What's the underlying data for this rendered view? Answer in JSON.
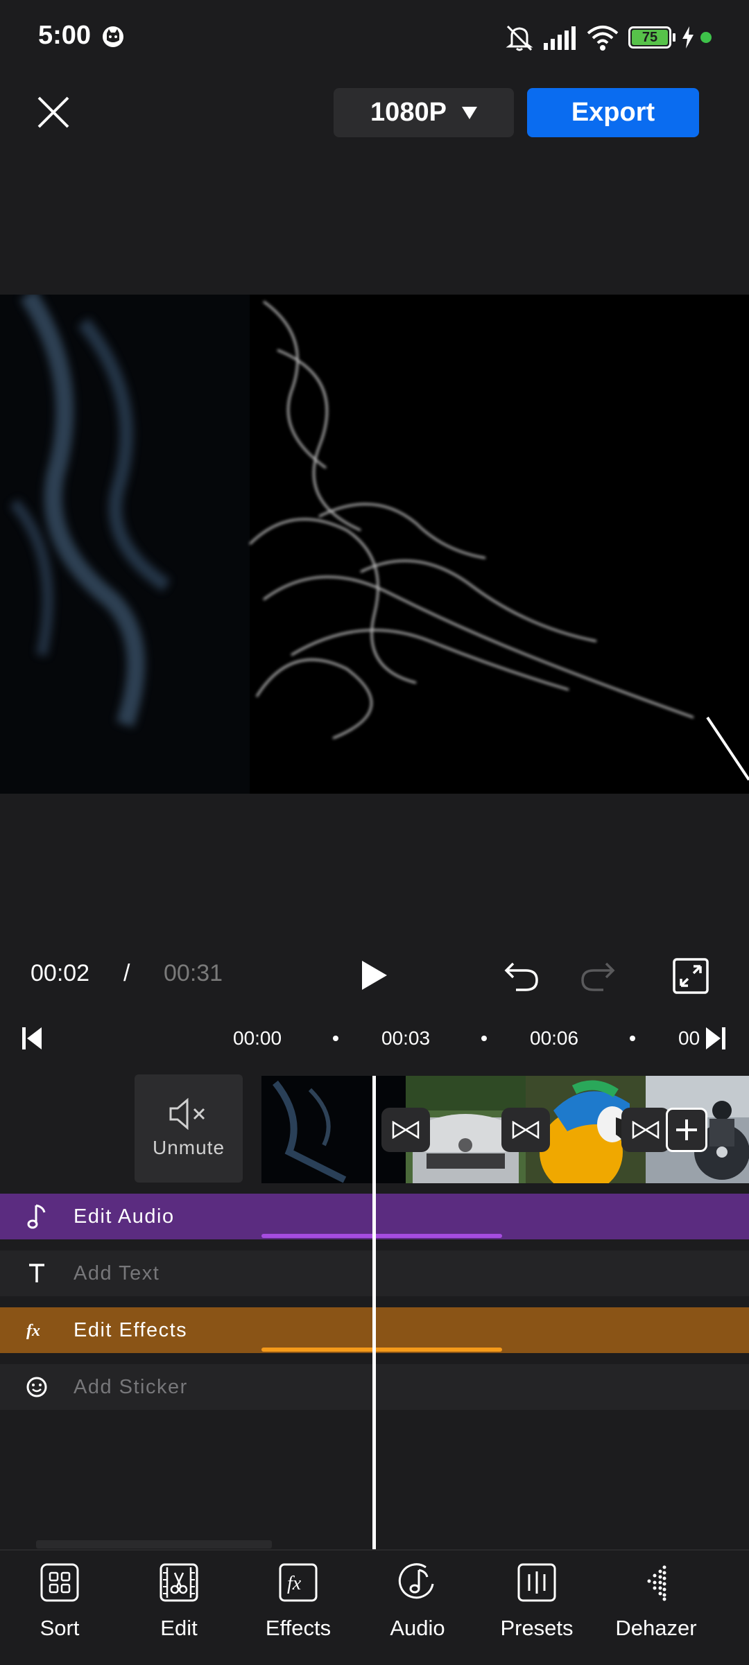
{
  "status_bar": {
    "time": "5:00",
    "battery_level": "75",
    "icons": [
      "cat-notification-icon",
      "mute-icon",
      "signal-icon",
      "wifi-icon",
      "battery-icon",
      "charging-icon",
      "dot-icon"
    ]
  },
  "top_bar": {
    "resolution": "1080P",
    "export_label": "Export",
    "close_icon": "close-icon"
  },
  "playback": {
    "current_time": "00:02",
    "separator": "/",
    "total_time": "00:31"
  },
  "ruler": {
    "ticks": [
      "00:00",
      "00:03",
      "00:06",
      "00"
    ]
  },
  "timeline": {
    "unmute_label": "Unmute",
    "tracks": {
      "audio": "Edit Audio",
      "text": "Add Text",
      "effects": "Edit Effects",
      "sticker": "Add Sticker"
    }
  },
  "bottom_nav": {
    "items": [
      {
        "label": "Sort",
        "icon": "sort-icon"
      },
      {
        "label": "Edit",
        "icon": "edit-scissors-icon"
      },
      {
        "label": "Effects",
        "icon": "effects-fx-icon"
      },
      {
        "label": "Audio",
        "icon": "audio-note-icon"
      },
      {
        "label": "Presets",
        "icon": "presets-icon"
      },
      {
        "label": "Dehazer",
        "icon": "dehazer-icon"
      }
    ]
  },
  "colors": {
    "background": "#1c1c1e",
    "accent_blue": "#0a6cf0",
    "audio_track": "#5b2c80",
    "effects_track": "#8a5416",
    "battery_green": "#57c24a"
  }
}
